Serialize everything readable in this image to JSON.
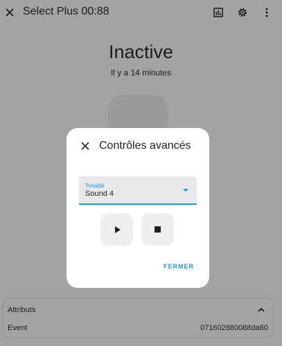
{
  "header": {
    "title": "Select Plus 00:88",
    "close_icon": "close-icon",
    "history_icon": "chart-box-icon",
    "settings_icon": "gear-icon",
    "menu_icon": "dots-vertical-icon"
  },
  "entity": {
    "state": "Inactive",
    "last_changed": "Il y a 14 minutes"
  },
  "attributes": {
    "title": "Attributs",
    "rows": [
      {
        "key": "Event",
        "value": "071602880088da60"
      }
    ]
  },
  "dialog": {
    "title": "Contrôles avancés",
    "select": {
      "label": "Tonalité",
      "value": "Sound 4"
    },
    "play_icon": "play-icon",
    "stop_icon": "stop-icon",
    "close_button": "FERMER"
  },
  "colors": {
    "accent": "#2196d6",
    "overlay_bg": "#a3a3a3",
    "dialog_bg": "#ffffff"
  }
}
